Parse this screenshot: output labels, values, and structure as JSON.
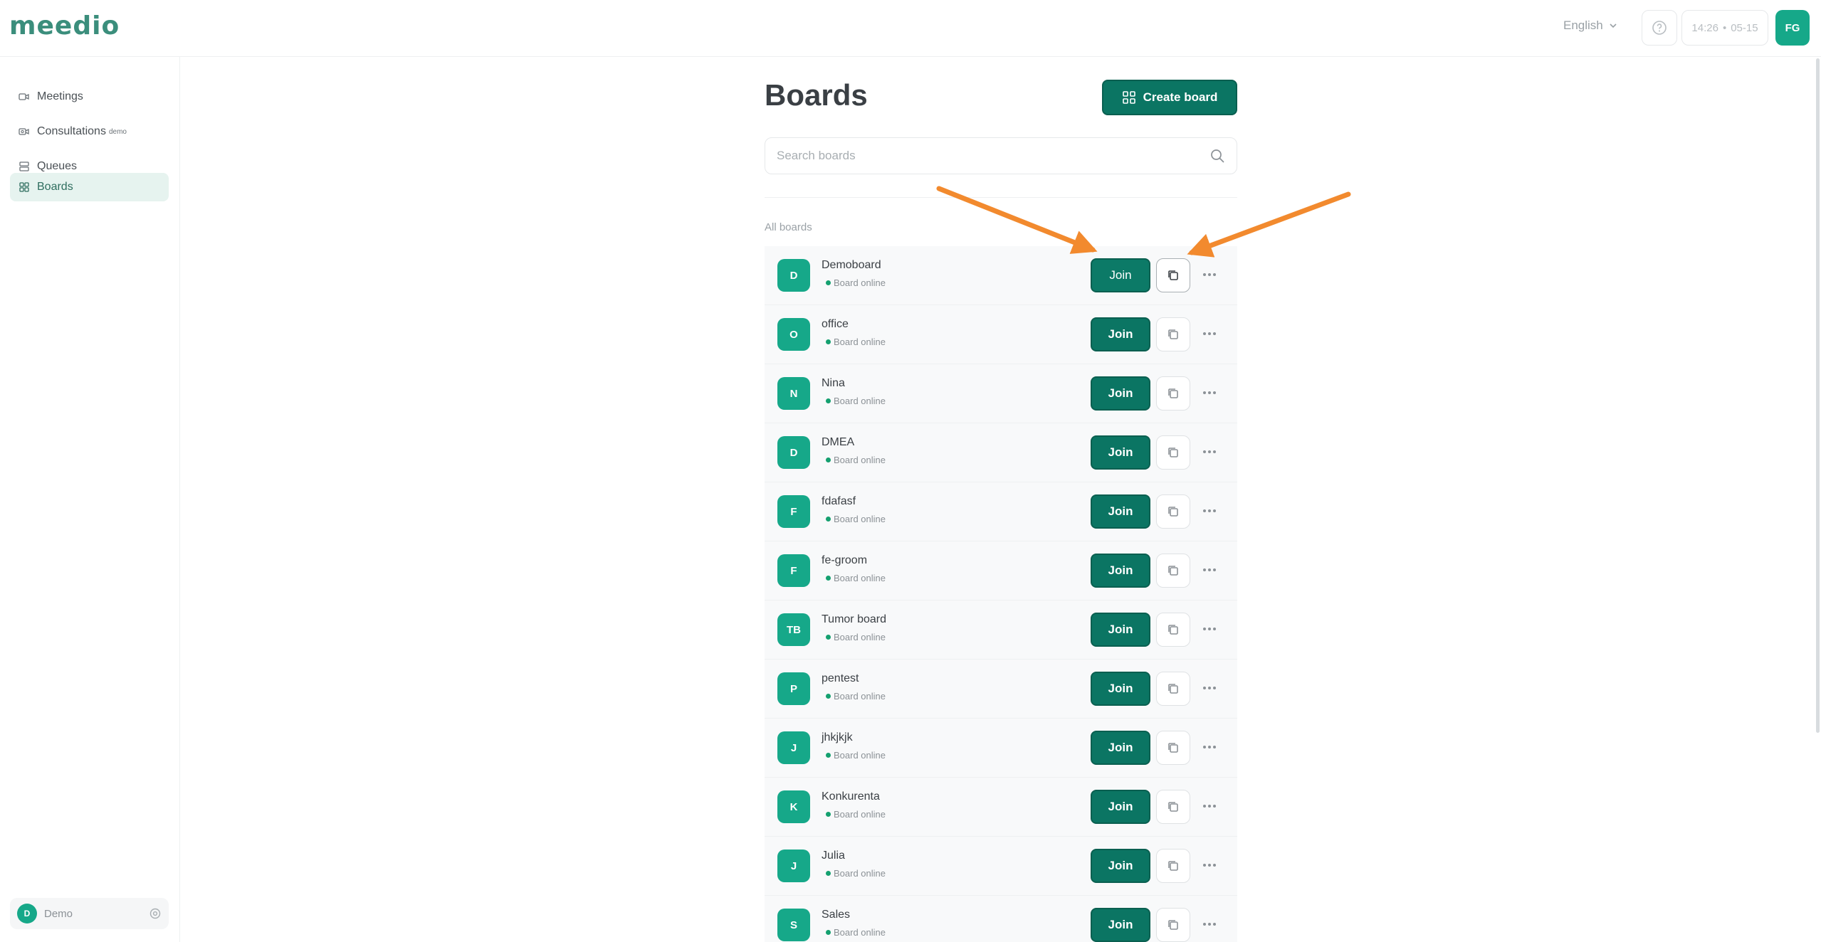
{
  "app": {
    "logo": "meedio"
  },
  "header": {
    "language": "English",
    "time": "14:26",
    "date": "05-15",
    "user_initials": "FG"
  },
  "sidebar": {
    "items": [
      {
        "label": "Meetings",
        "icon": "video-camera-icon",
        "active": false
      },
      {
        "label": "Consultations",
        "badge": "demo",
        "icon": "video-consult-icon",
        "active": false
      },
      {
        "label": "Queues",
        "icon": "queue-icon",
        "active": false
      },
      {
        "label": "Boards",
        "icon": "grid-icon",
        "active": true
      }
    ],
    "team": {
      "initial": "D",
      "name": "Demo"
    }
  },
  "main": {
    "title": "Boards",
    "create_label": "Create board",
    "search_placeholder": "Search boards",
    "section_label": "All boards",
    "join_label": "Join",
    "boards": [
      {
        "initials": "D",
        "name": "Demoboard",
        "status": "Board online"
      },
      {
        "initials": "O",
        "name": "office",
        "status": "Board online"
      },
      {
        "initials": "N",
        "name": "Nina",
        "status": "Board online"
      },
      {
        "initials": "D",
        "name": "DMEA",
        "status": "Board online"
      },
      {
        "initials": "F",
        "name": "fdafasf",
        "status": "Board online"
      },
      {
        "initials": "F",
        "name": "fe-groom",
        "status": "Board online"
      },
      {
        "initials": "TB",
        "name": "Tumor board",
        "status": "Board online"
      },
      {
        "initials": "P",
        "name": "pentest",
        "status": "Board online"
      },
      {
        "initials": "J",
        "name": "jhkjkjk",
        "status": "Board online"
      },
      {
        "initials": "K",
        "name": "Konkurenta",
        "status": "Board online"
      },
      {
        "initials": "J",
        "name": "Julia",
        "status": "Board online"
      },
      {
        "initials": "S",
        "name": "Sales",
        "status": "Board online"
      }
    ]
  },
  "colors": {
    "accent": "#0b7563",
    "badge": "#16a889",
    "annotation_arrow": "#f28a2e"
  }
}
